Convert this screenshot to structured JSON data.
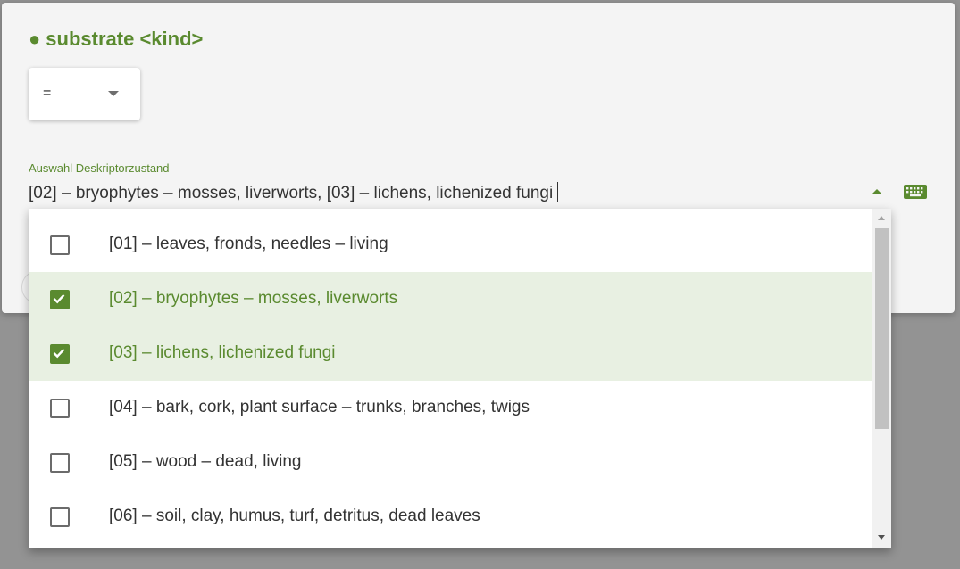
{
  "dialog": {
    "title_dot": "●",
    "title": "substrate <kind>"
  },
  "operator_select": {
    "value": "="
  },
  "state_field": {
    "label": "Auswahl Deskriptorzustand",
    "value": "[02] – bryophytes – mosses, liverworts, [03] – lichens, lichenized fungi"
  },
  "dropdown": {
    "options": [
      {
        "label": "[01] – leaves, fronds, needles – living",
        "checked": false
      },
      {
        "label": "[02] – bryophytes – mosses, liverworts",
        "checked": true
      },
      {
        "label": "[03] – lichens, lichenized fungi",
        "checked": true
      },
      {
        "label": "[04] – bark, cork, plant surface – trunks, branches, twigs",
        "checked": false
      },
      {
        "label": "[05] – wood – dead, living",
        "checked": false
      },
      {
        "label": "[06] – soil, clay, humus, turf, detritus, dead leaves",
        "checked": false
      }
    ]
  },
  "icons": {
    "keyboard": "keyboard-icon",
    "check": "check-icon",
    "dropdown_arrow": "chevron-down-icon"
  },
  "colors": {
    "accent": "#5a8a2f",
    "selected_row": "#e8f0e2",
    "backdrop": "#939393"
  }
}
